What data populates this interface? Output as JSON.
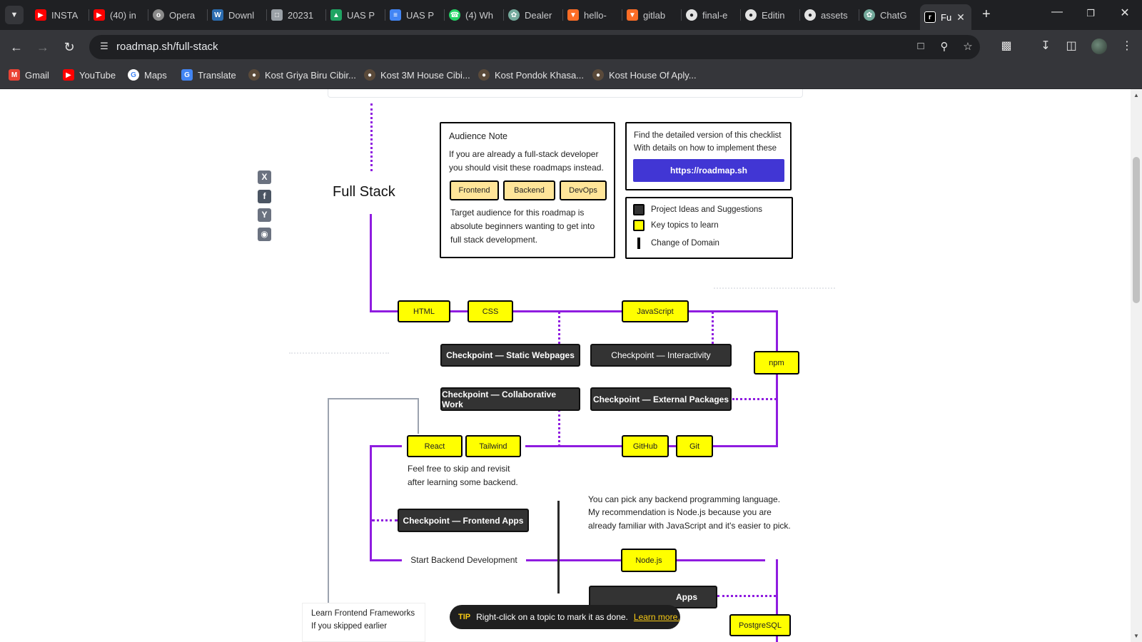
{
  "browser": {
    "tabs": [
      {
        "label": "INSTA",
        "icon": "youtube-icon",
        "color": "#ff0000"
      },
      {
        "label": "(40) in",
        "icon": "youtube-icon",
        "color": "#ff0000"
      },
      {
        "label": "Opera",
        "icon": "globe-icon",
        "color": "#8a8a8a"
      },
      {
        "label": "Downl",
        "icon": "document-icon",
        "color": "#2b6cb0"
      },
      {
        "label": "20231",
        "icon": "file-icon",
        "color": "#9aa0a6"
      },
      {
        "label": "UAS P",
        "icon": "drive-icon",
        "color": "#1fa463"
      },
      {
        "label": "UAS P",
        "icon": "docs-icon",
        "color": "#4285f4"
      },
      {
        "label": "(4) Wh",
        "icon": "whatsapp-icon",
        "color": "#25d366"
      },
      {
        "label": "Dealer",
        "icon": "chatgpt-icon",
        "color": "#74aa9c"
      },
      {
        "label": "hello-",
        "icon": "gitlab-icon",
        "color": "#fc6d26"
      },
      {
        "label": "gitlab",
        "icon": "gitlab-icon",
        "color": "#fc6d26"
      },
      {
        "label": "final-e",
        "icon": "github-icon",
        "color": "#e3e3e3"
      },
      {
        "label": "Editin",
        "icon": "github-icon",
        "color": "#e3e3e3"
      },
      {
        "label": "assets",
        "icon": "github-icon",
        "color": "#e3e3e3"
      },
      {
        "label": "ChatG",
        "icon": "chatgpt-icon",
        "color": "#74aa9c"
      },
      {
        "label": "Fu",
        "icon": "roadmap-icon",
        "color": "#ffffff"
      }
    ],
    "url": "roadmap.sh/full-stack",
    "bookmarks": [
      {
        "label": "Gmail",
        "icon": "gmail-icon"
      },
      {
        "label": "YouTube",
        "icon": "youtube-icon"
      },
      {
        "label": "Maps",
        "icon": "google-icon"
      },
      {
        "label": "Translate",
        "icon": "translate-icon"
      },
      {
        "label": "Kost Griya Biru Cibir...",
        "icon": "kost-icon"
      },
      {
        "label": "Kost 3M House Cibi...",
        "icon": "kost-icon"
      },
      {
        "label": "Kost Pondok Khasa...",
        "icon": "kost-icon"
      },
      {
        "label": "Kost House Of Aply...",
        "icon": "kost-icon"
      }
    ]
  },
  "page": {
    "title": "Full Stack",
    "share_icons": [
      "x-icon",
      "facebook-icon",
      "ycombinator-icon",
      "reddit-icon"
    ],
    "audience": {
      "heading": "Audience Note",
      "intro_lines": [
        "If you are already a full-stack developer",
        "you should visit these roadmaps instead."
      ],
      "buttons": [
        "Frontend",
        "Backend",
        "DevOps"
      ],
      "target_lines": [
        "Target audience for this roadmap is",
        "absolute beginners wanting to get into",
        "full stack development."
      ]
    },
    "checklist": {
      "lines": [
        "Find the detailed version of this checklist",
        "With details on how to implement these"
      ],
      "link": "https://roadmap.sh"
    },
    "legend": [
      {
        "label": "Project Ideas and Suggestions",
        "color": "#333333"
      },
      {
        "label": "Key topics to learn",
        "color": "#ffff00"
      },
      {
        "label": "Change of Domain",
        "color": "#000000"
      }
    ],
    "topics": {
      "html": "HTML",
      "css": "CSS",
      "javascript": "JavaScript",
      "npm": "npm",
      "react": "React",
      "tailwind": "Tailwind",
      "github": "GitHub",
      "git": "Git",
      "nodejs": "Node.js",
      "postgresql": "PostgreSQL"
    },
    "checkpoints": {
      "static": "Checkpoint — Static Webpages",
      "interactivity": "Checkpoint — Interactivity",
      "collaborative": "Checkpoint — Collaborative Work",
      "external": "Checkpoint — External Packages",
      "frontend_apps": "Checkpoint — Frontend Apps",
      "cli_apps_partial": "Apps"
    },
    "notes": {
      "skip_lines": [
        "Feel free to skip and revisit",
        "after learning some backend."
      ],
      "backend_lines": [
        "You can pick any backend programming language.",
        "My recommendation is Node.js because you are",
        "already familiar with JavaScript and it's easier to pick."
      ],
      "start_backend": "Start Backend Development",
      "learn_frameworks": [
        "Learn Frontend Frameworks",
        "If you skipped earlier"
      ]
    },
    "tip": {
      "tag": "TIP",
      "text": "Right-click on a topic to mark it as done.",
      "link": "Learn more."
    }
  },
  "colors": {
    "roadmap_line": "#8f1ce0",
    "topic": "#ffff00",
    "checkpoint": "#333333",
    "cta": "#4136d4",
    "beige": "#ffe599"
  }
}
